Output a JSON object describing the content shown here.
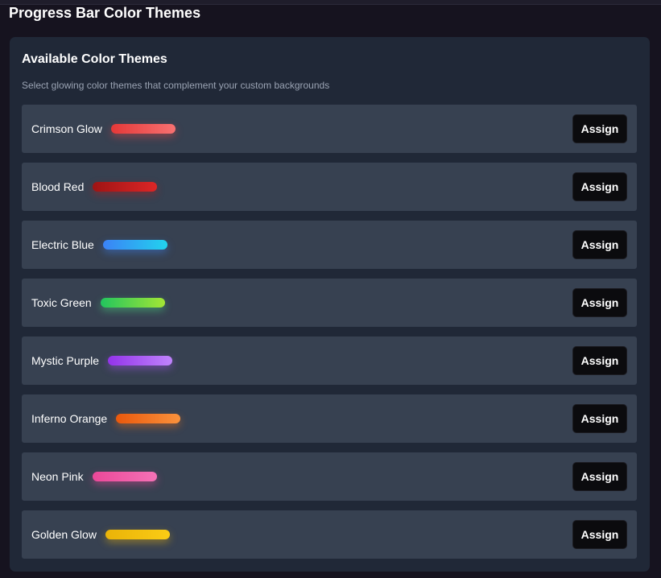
{
  "page": {
    "title": "Progress Bar Color Themes"
  },
  "card": {
    "title": "Available Color Themes",
    "subtitle": "Select glowing color themes that complement your custom backgrounds"
  },
  "themes": [
    {
      "name": "Crimson Glow",
      "colors": [
        "#e53838",
        "#f87171"
      ],
      "button": "Assign"
    },
    {
      "name": "Blood Red",
      "colors": [
        "#9f1414",
        "#dc2626"
      ],
      "button": "Assign"
    },
    {
      "name": "Electric Blue",
      "colors": [
        "#3b82f6",
        "#22d3ee"
      ],
      "button": "Assign"
    },
    {
      "name": "Toxic Green",
      "colors": [
        "#22c55e",
        "#a3e635"
      ],
      "button": "Assign"
    },
    {
      "name": "Mystic Purple",
      "colors": [
        "#9333ea",
        "#c084fc"
      ],
      "button": "Assign"
    },
    {
      "name": "Inferno Orange",
      "colors": [
        "#ea580c",
        "#fb923c"
      ],
      "button": "Assign"
    },
    {
      "name": "Neon Pink",
      "colors": [
        "#ec4899",
        "#f472b6"
      ],
      "button": "Assign"
    },
    {
      "name": "Golden Glow",
      "colors": [
        "#eab308",
        "#facc15"
      ],
      "button": "Assign"
    }
  ]
}
